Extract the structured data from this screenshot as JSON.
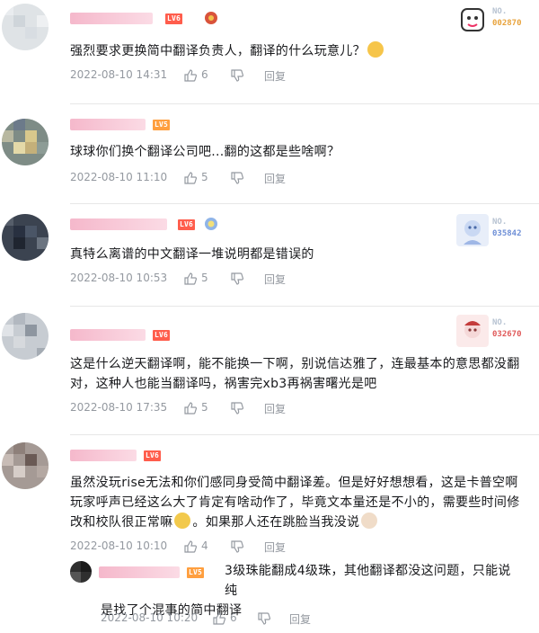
{
  "comments": [
    {
      "level": "LV6",
      "text": "强烈要求更换简中翻译负责人，翻译的什么玩意儿？",
      "date": "2022-08-10 14:31",
      "likes": "6",
      "reply_label": "回复",
      "card": {
        "no_label": "NO.",
        "number": "002870",
        "number_color": "#e8a33c"
      }
    },
    {
      "level": "LV5",
      "text": "球球你们换个翻译公司吧...翻的这都是些啥啊？",
      "date": "2022-08-10 11:10",
      "likes": "5",
      "reply_label": "回复"
    },
    {
      "level": "LV6",
      "text": "真特么离谱的中文翻译一堆说明都是错误的",
      "date": "2022-08-10 10:53",
      "likes": "5",
      "reply_label": "回复",
      "card": {
        "no_label": "NO.",
        "number": "035842",
        "number_color": "#6e8fd6"
      }
    },
    {
      "level": "LV6",
      "text_lines": [
        "这是什么逆天翻译啊，能不能换一下啊，别说信达雅了，连最基本的意思都没翻",
        "对，这种人也能当翻译吗，祸害完xb3再祸害曙光是吧"
      ],
      "date": "2022-08-10 17:35",
      "likes": "5",
      "reply_label": "回复",
      "card": {
        "no_label": "NO.",
        "number": "032670",
        "number_color": "#e05a5a"
      }
    },
    {
      "level": "LV6",
      "text_lines": [
        "虽然没玩rise无法和你们感同身受简中翻译差。但是好好想想看，这是卡普空啊",
        "玩家呼声已经这么大了肯定有啥动作了，毕竟文本量还是不小的，需要些时间修",
        "改和校队很正常嘛",
        "。如果那人还在跳脸当我没说"
      ],
      "date": "2022-08-10 10:10",
      "likes": "4",
      "reply_label": "回复",
      "reply": {
        "level": "LV5",
        "text_lines": [
          "3级珠能翻成4级珠，其他翻译都没这问题，只能说纯",
          "是找了个混事的简中翻译"
        ],
        "date": "2022-08-10 10:20",
        "likes": "6",
        "reply_label": "回复"
      }
    }
  ],
  "colors": {
    "meta": "#9499a0",
    "lv6": "#ff5d4c",
    "lv5": "#ff9f3f",
    "username_blur": "#f5b8cb"
  }
}
